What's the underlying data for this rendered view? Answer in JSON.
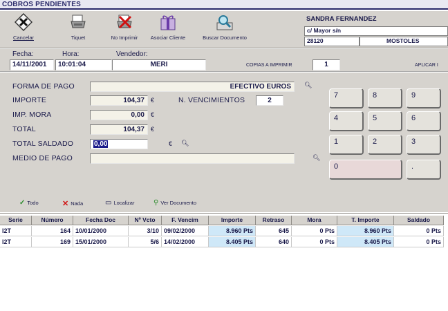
{
  "window": {
    "title": "COBROS PENDIENTES"
  },
  "toolbar": {
    "buttons": [
      {
        "label": "Cancelar",
        "icon": "cancel-icon"
      },
      {
        "label": "Tiquet",
        "icon": "printer-icon"
      },
      {
        "label": "No Imprimir",
        "icon": "no-print-icon"
      },
      {
        "label": "Asociar Cliente",
        "icon": "associate-client-icon"
      },
      {
        "label": "Buscar Documento",
        "icon": "search-document-icon"
      }
    ]
  },
  "customer": {
    "name": "SANDRA FERNANDEZ",
    "address": "c/ Mayor s/n",
    "postal_code": "28120",
    "city": "MOSTOLES"
  },
  "info": {
    "date_label": "Fecha:",
    "date": "14/11/2001",
    "time_label": "Hora:",
    "time": "10:01:04",
    "seller_label": "Vendedor:",
    "seller": "MERI",
    "copies_label": "COPIAS A IMPRIMIR",
    "copies": "1",
    "apply_label": "APLICAR I"
  },
  "form": {
    "payment_method_label": "FORMA DE PAGO",
    "payment_method": "EFECTIVO EUROS",
    "amount_label": "IMPORTE",
    "amount": "104,37",
    "late_fee_label": "IMP. MORA",
    "late_fee": "0,00",
    "total_label": "TOTAL",
    "total": "104,37",
    "total_paid_label": "TOTAL SALDADO",
    "total_paid": "0,00",
    "medium_label": "MEDIO DE PAGO",
    "medium": "",
    "due_count_label": "N. VENCIMIENTOS",
    "due_count": "2",
    "currency": "€"
  },
  "numpad": {
    "keys": [
      "7",
      "8",
      "9",
      "4",
      "5",
      "6",
      "1",
      "2",
      "3",
      "0",
      "."
    ]
  },
  "actions": [
    {
      "label": "Todo",
      "icon": "check-icon"
    },
    {
      "label": "Nada",
      "icon": "x-icon"
    },
    {
      "label": "Localizar",
      "icon": "locate-icon"
    },
    {
      "label": "Ver Documento",
      "icon": "view-document-icon"
    }
  ],
  "table": {
    "headers": [
      "Serie",
      "Número",
      "Fecha Doc",
      "Nº Vcto",
      "F. Vencim",
      "Importe",
      "Retraso",
      "Mora",
      "T. Importe",
      "Saldado"
    ],
    "rows": [
      [
        "I2T",
        "164",
        "10/01/2000",
        "3/10",
        "09/02/2000",
        "8.960 Pts",
        "645",
        "0 Pts",
        "8.960 Pts",
        "0 Pts"
      ],
      [
        "I2T",
        "169",
        "15/01/2000",
        "5/6",
        "14/02/2000",
        "8.405 Pts",
        "640",
        "0 Pts",
        "8.405 Pts",
        "0 Pts"
      ]
    ]
  },
  "colors": {
    "panel": "#d6d3ce",
    "title_text": "#2a2a6a",
    "highlight_cell": "#cfe8f8"
  }
}
